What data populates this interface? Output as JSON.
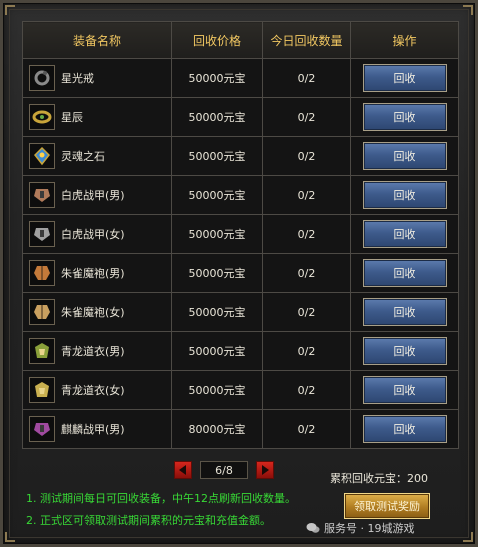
{
  "table": {
    "headers": [
      "装备名称",
      "回收价格",
      "今日回收数量",
      "操作"
    ],
    "rows": [
      {
        "icon": "ring-icon",
        "name": "星光戒",
        "price": "50000元宝",
        "count": "0/2",
        "action": "回收",
        "color": "#8a8a8a"
      },
      {
        "icon": "bracelet-icon",
        "name": "星辰",
        "price": "50000元宝",
        "count": "0/2",
        "action": "回收",
        "color": "#c9a53a"
      },
      {
        "icon": "soul-stone-icon",
        "name": "灵魂之石",
        "price": "50000元宝",
        "count": "0/2",
        "action": "回收",
        "color": "#3a8ad6"
      },
      {
        "icon": "armor-icon",
        "name": "白虎战甲(男)",
        "price": "50000元宝",
        "count": "0/2",
        "action": "回收",
        "color": "#b07a5a"
      },
      {
        "icon": "armor-icon",
        "name": "白虎战甲(女)",
        "price": "50000元宝",
        "count": "0/2",
        "action": "回收",
        "color": "#a0a0a0"
      },
      {
        "icon": "robe-icon",
        "name": "朱雀魔袍(男)",
        "price": "50000元宝",
        "count": "0/2",
        "action": "回收",
        "color": "#c47a3a"
      },
      {
        "icon": "robe-icon",
        "name": "朱雀魔袍(女)",
        "price": "50000元宝",
        "count": "0/2",
        "action": "回收",
        "color": "#c9a060"
      },
      {
        "icon": "garment-icon",
        "name": "青龙道衣(男)",
        "price": "50000元宝",
        "count": "0/2",
        "action": "回收",
        "color": "#8aa03a"
      },
      {
        "icon": "garment-icon",
        "name": "青龙道衣(女)",
        "price": "50000元宝",
        "count": "0/2",
        "action": "回收",
        "color": "#c9b050"
      },
      {
        "icon": "armor-icon",
        "name": "麒麟战甲(男)",
        "price": "80000元宝",
        "count": "0/2",
        "action": "回收",
        "color": "#a04aa0"
      }
    ]
  },
  "pager": {
    "current": "6/8",
    "prev_icon": "arrow-left-icon",
    "next_icon": "arrow-right-icon"
  },
  "total": "累积回收元宝：200",
  "notes": [
    "1. 测试期间每日可回收装备，中午12点刷新回收数量。",
    "2. 正式区可领取测试期间累积的元宝和充值金额。"
  ],
  "claim_button": "领取测试奖励",
  "watermark": "服务号 · 19城游戏",
  "colors": {
    "header_text": "#f2c862",
    "note_text": "#38d936",
    "button_blue": "#3e5b8c"
  }
}
